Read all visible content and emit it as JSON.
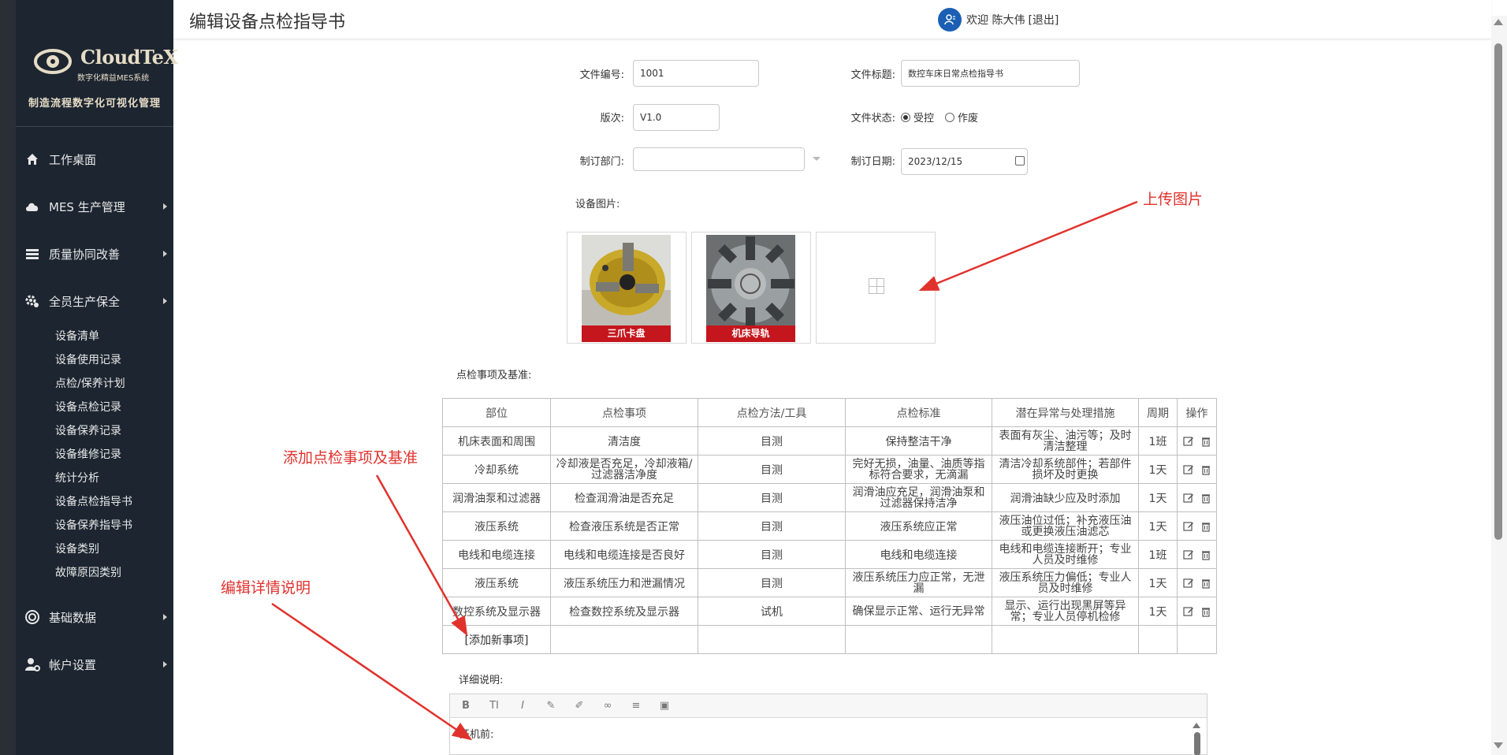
{
  "sidebar": {
    "logo_title": "CloudTeX",
    "logo_subtitle": "数字化精益MES系统",
    "tagline": "制造流程数字化可视化管理",
    "menu": [
      {
        "label": "工作桌面",
        "icon": "home-icon",
        "has_arrow": false
      },
      {
        "label": "MES 生产管理",
        "icon": "cloud-icon",
        "has_arrow": true
      },
      {
        "label": "质量协同改善",
        "icon": "layers-icon",
        "has_arrow": true
      },
      {
        "label": "全员生产保全",
        "icon": "gears-icon",
        "has_arrow": true,
        "active": true
      },
      {
        "label": "基础数据",
        "icon": "settings-icon",
        "has_arrow": true
      },
      {
        "label": "帐户设置",
        "icon": "user-gear-icon",
        "has_arrow": true
      }
    ],
    "submenu": [
      "设备清单",
      "设备使用记录",
      "点检/保养计划",
      "设备点检记录",
      "设备保养记录",
      "设备维修记录",
      "统计分析",
      "设备点检指导书",
      "设备保养指导书",
      "设备类别",
      "故障原因类别"
    ]
  },
  "header": {
    "title": "编辑设备点检指导书",
    "welcome": "欢迎 陈大伟",
    "logout": "[退出]"
  },
  "form": {
    "doc_no_label": "文件编号:",
    "doc_no": "1001",
    "doc_title_label": "文件标题:",
    "doc_title": "数控车床日常点检指导书",
    "version_label": "版次:",
    "version": "V1.0",
    "status_label": "文件状态:",
    "status_options": [
      "受控",
      "作废"
    ],
    "status_selected": "受控",
    "dept_label": "制订部门:",
    "dept": "",
    "date_label": "制订日期:",
    "date": "2023/12/15",
    "images_label": "设备图片:",
    "images": [
      {
        "caption": "三爪卡盘",
        "icon": "chuck-photo"
      },
      {
        "caption": "机床导轨",
        "icon": "guide-rail-photo"
      }
    ],
    "items_label": "点检事项及基准:",
    "detail_label": "详细说明:"
  },
  "table": {
    "headers": [
      "部位",
      "点检事项",
      "点检方法/工具",
      "点检标准",
      "潜在异常与处理措施",
      "周期",
      "操作"
    ],
    "rows": [
      [
        "机床表面和周围",
        "清洁度",
        "目测",
        "保持整洁干净",
        "表面有灰尘、油污等；及时清洁整理",
        "1班"
      ],
      [
        "冷却系统",
        "冷却液是否充足，冷却液箱/过滤器洁净度",
        "目测",
        "完好无损，油量、油质等指标符合要求，无滴漏",
        "清洁冷却系统部件；若部件损坏及时更换",
        "1天"
      ],
      [
        "润滑油泵和过滤器",
        "检查润滑油是否充足",
        "目测",
        "润滑油应充足，润滑油泵和过滤器保持洁净",
        "润滑油缺少应及时添加",
        "1天"
      ],
      [
        "液压系统",
        "检查液压系统是否正常",
        "目测",
        "液压系统应正常",
        "液压油位过低；补充液压油或更换液压油滤芯",
        "1天"
      ],
      [
        "电线和电缆连接",
        "电线和电缆连接是否良好",
        "目测",
        "电线和电缆连接",
        "电线和电缆连接断开；专业人员及时维修",
        "1班"
      ],
      [
        "液压系统",
        "液压系统压力和泄漏情况",
        "目测",
        "液压系统压力应正常，无泄漏",
        "液压系统压力偏低；专业人员及时维修",
        "1天"
      ],
      [
        "数控系统及显示器",
        "检查数控系统及显示器",
        "试机",
        "确保显示正常、运行无异常",
        "显示、运行出现黑屏等异常；专业人员停机检修",
        "1天"
      ]
    ],
    "add_row": "[添加新事项]"
  },
  "editor": {
    "toolbar": [
      "bold-icon",
      "font-size-icon",
      "italic-icon",
      "highlight-icon",
      "brush-icon",
      "link-icon",
      "align-icon",
      "image-icon"
    ],
    "toolbar_glyphs": [
      "B",
      "TI",
      "I",
      "✎",
      "✐",
      "∞",
      "≡",
      "▣"
    ],
    "content": "开机前:"
  },
  "annotations": {
    "upload": "上传图片",
    "add_items": "添加点检事项及基准",
    "edit_detail": "编辑详情说明"
  },
  "colors": {
    "sidebar_bg": "#2a2f36",
    "sidebar_panel": "#1c2530",
    "accent_red": "#e0322d",
    "caption_red": "#c4161c",
    "avatar_blue": "#1a5fb4"
  }
}
